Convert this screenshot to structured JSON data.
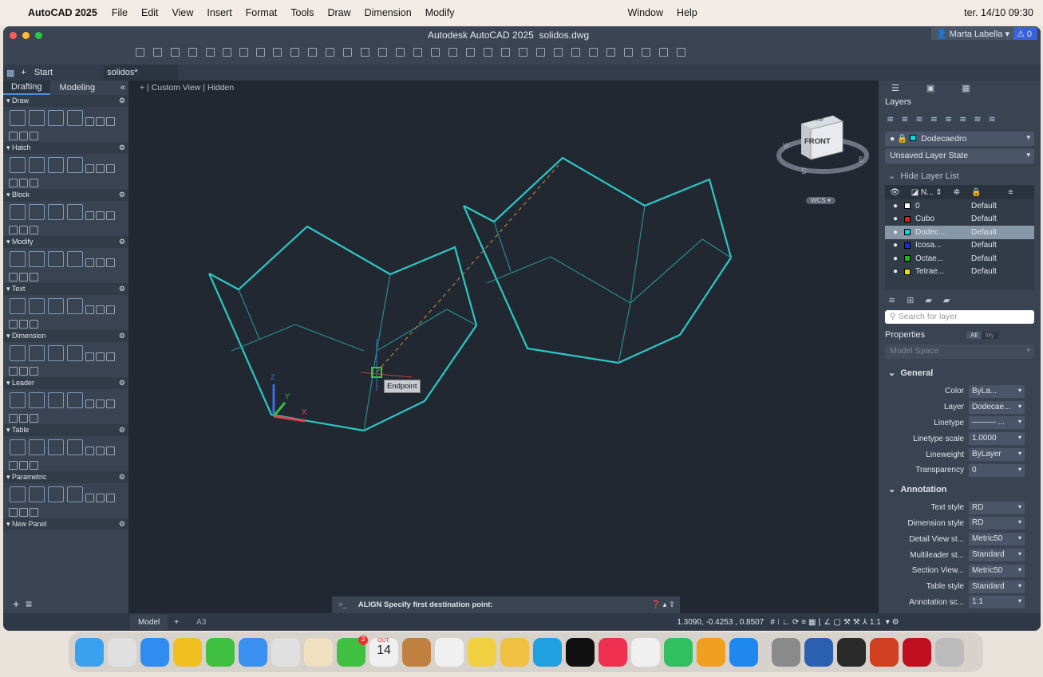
{
  "menubar": {
    "app": "AutoCAD 2025",
    "items": [
      "File",
      "Edit",
      "View",
      "Insert",
      "Format",
      "Tools",
      "Draw",
      "Dimension",
      "Modify"
    ],
    "right_items": [
      "Window",
      "Help"
    ],
    "clock": "ter. 14/10  09:30"
  },
  "window": {
    "title": "Autodesk AutoCAD 2025",
    "file": "solidos.dwg",
    "user": "Marta Labella",
    "alerts": "0"
  },
  "tabs": {
    "start": "Start",
    "file": "solidos*"
  },
  "left_palette": {
    "tabs": [
      "Drafting",
      "Modeling"
    ],
    "panels": [
      "Draw",
      "Hatch",
      "Block",
      "Modify",
      "Text",
      "Dimension",
      "Leader",
      "Table",
      "Parametric",
      "New Panel"
    ]
  },
  "viewport": {
    "controls": [
      "+",
      "Custom View",
      "Hidden"
    ],
    "viewcube": {
      "top": "TOP",
      "front": "FRONT",
      "compass": [
        "W",
        "S",
        "E"
      ],
      "wcs": "WCS"
    },
    "tooltip": "Endpoint",
    "ucs": {
      "z": "Z",
      "y": "Y",
      "x": "X"
    }
  },
  "command_line": {
    "prompt": ">_",
    "text": "ALIGN Specify first destination point:"
  },
  "layers": {
    "title": "Layers",
    "current": "Dodecaedro",
    "state": "Unsaved Layer State",
    "hide_list": "Hide Layer List",
    "col_name": "N...",
    "search_placeholder": "Search for layer",
    "rows": [
      {
        "name": "0",
        "color": "#ffffff",
        "lt": "Default"
      },
      {
        "name": "Cubo",
        "color": "#e02020",
        "lt": "Default"
      },
      {
        "name": "Dodec...",
        "color": "#00d8e0",
        "lt": "Default"
      },
      {
        "name": "Icosa...",
        "color": "#1030e0",
        "lt": "Default"
      },
      {
        "name": "Octae...",
        "color": "#10c010",
        "lt": "Default"
      },
      {
        "name": "Tetrae...",
        "color": "#f0e000",
        "lt": "Default"
      }
    ]
  },
  "properties": {
    "title": "Properties",
    "all": "All",
    "my": "My",
    "space": "Model Space",
    "general": "General",
    "annotation": "Annotation",
    "general_rows": [
      {
        "label": "Color",
        "value": "ByLa..."
      },
      {
        "label": "Layer",
        "value": "Dodecae..."
      },
      {
        "label": "Linetype",
        "value": "——— ..."
      },
      {
        "label": "Linetype scale",
        "value": "1.0000"
      },
      {
        "label": "Lineweight",
        "value": "ByLayer"
      },
      {
        "label": "Transparency",
        "value": "0"
      }
    ],
    "annotation_rows": [
      {
        "label": "Text style",
        "value": "RD"
      },
      {
        "label": "Dimension style",
        "value": "RD"
      },
      {
        "label": "Detail View st...",
        "value": "Metric50"
      },
      {
        "label": "Multileader st...",
        "value": "Standard"
      },
      {
        "label": "Section View...",
        "value": "Metric50"
      },
      {
        "label": "Table style",
        "value": "Standard"
      },
      {
        "label": "Annotation sc...",
        "value": "1:1"
      }
    ]
  },
  "status": {
    "model": "Model",
    "layout": "A3",
    "coords": "1.3090,     -0.4253  , 0.8507",
    "scale": "1:1"
  },
  "dock": {
    "calendar_month": "OUT.",
    "calendar_day": "14",
    "facetime_badge": "3"
  }
}
